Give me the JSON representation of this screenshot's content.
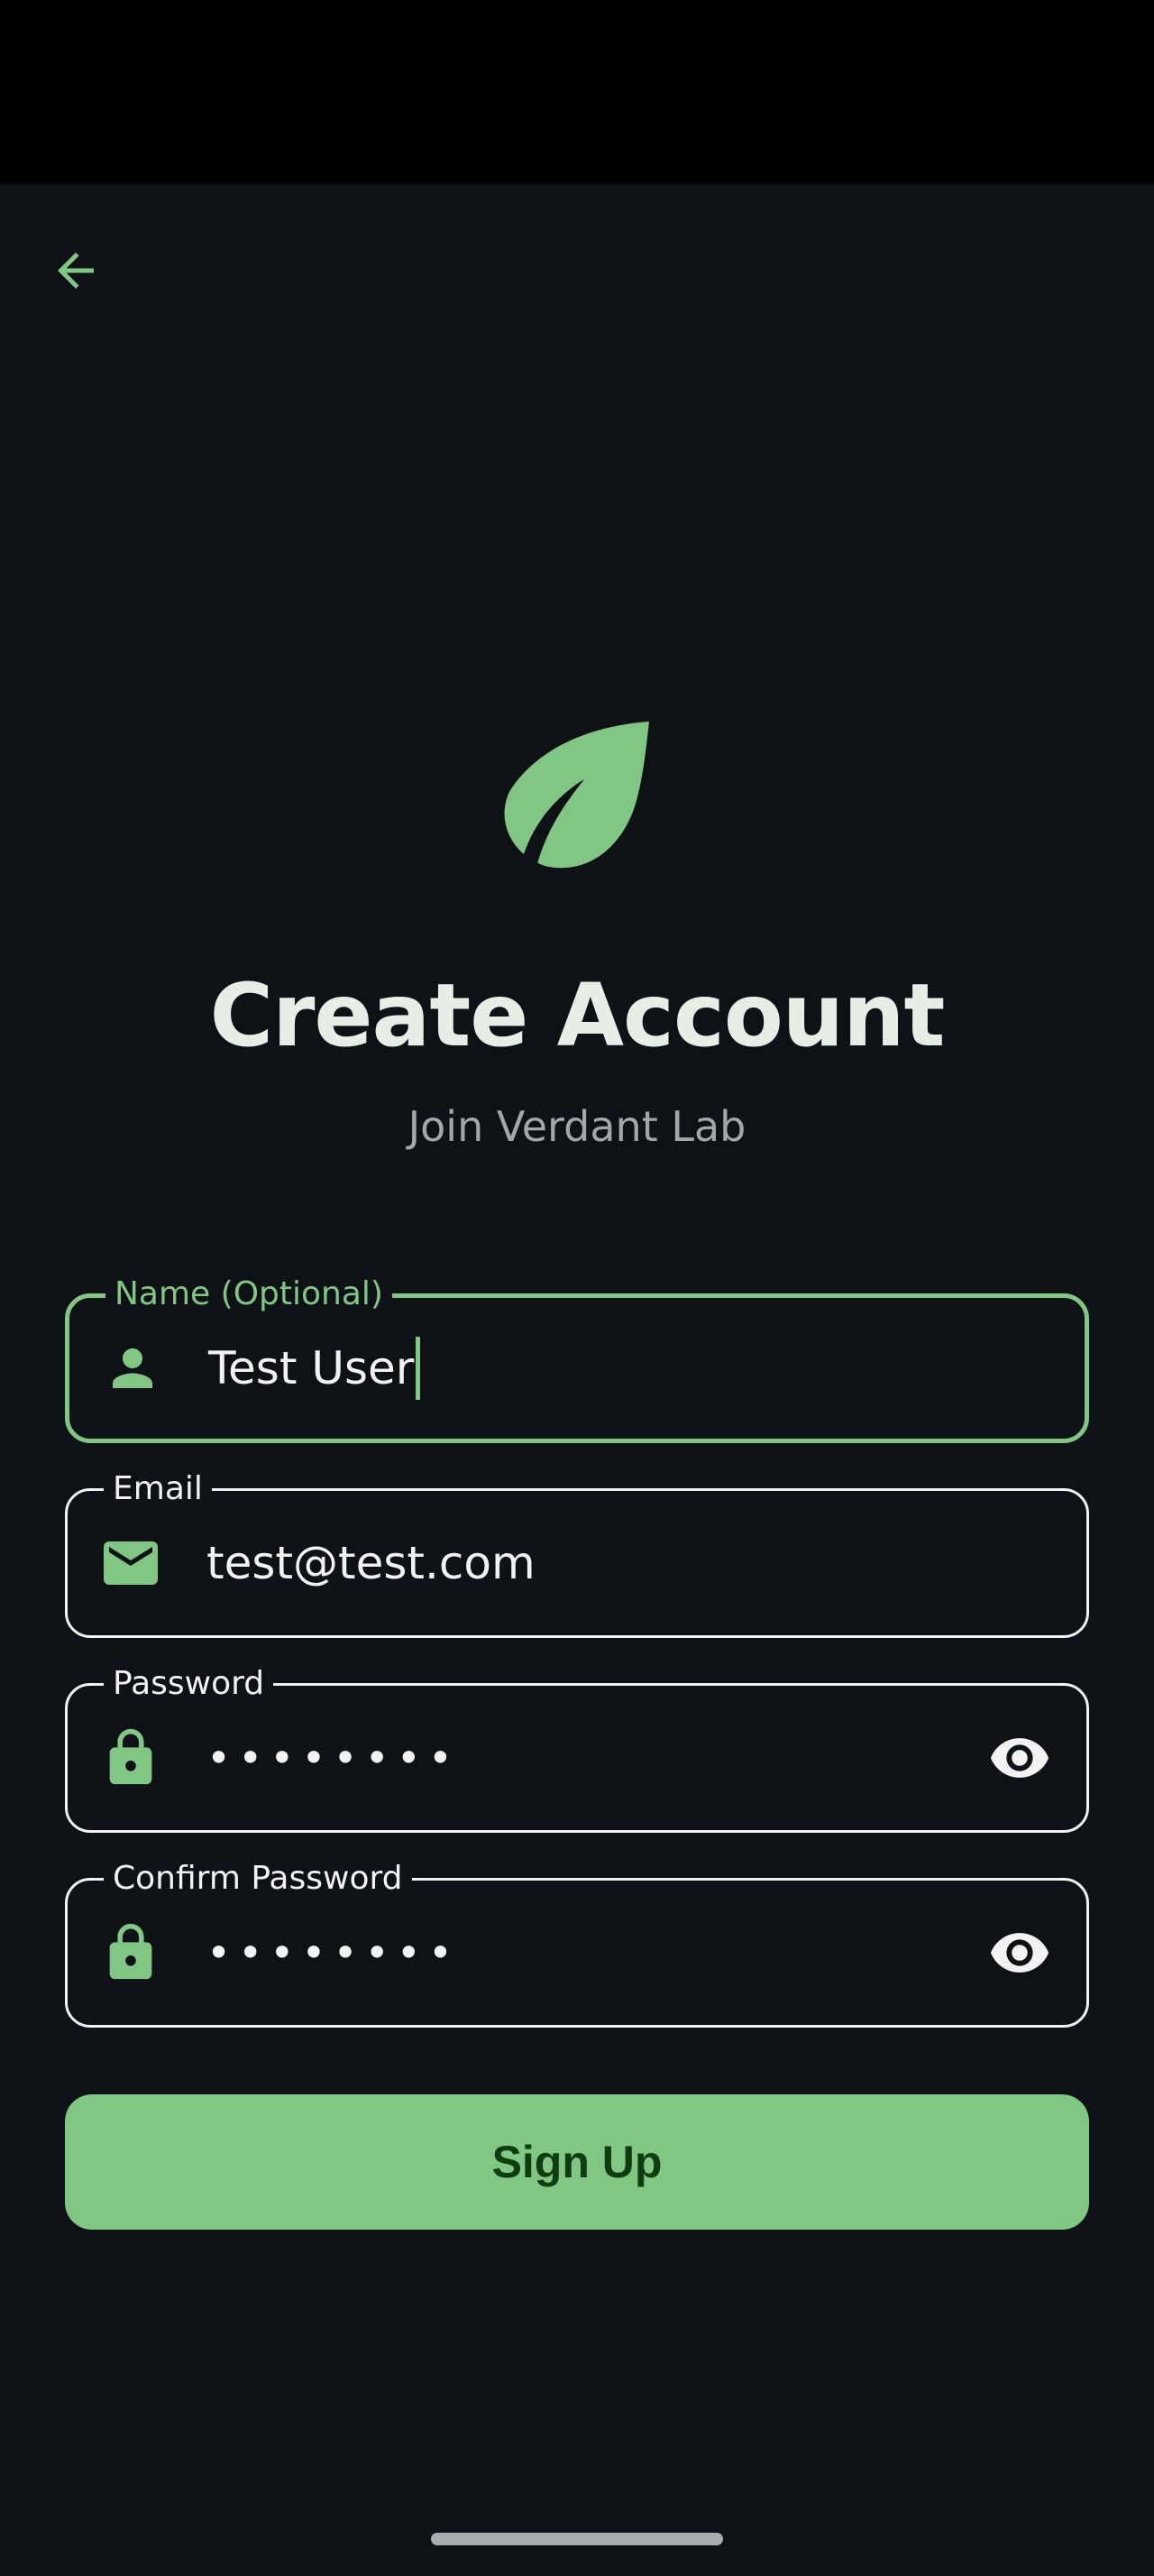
{
  "header": {
    "back_icon": "arrow-left-icon"
  },
  "branding": {
    "logo_icon": "leaf-icon",
    "title": "Create Account",
    "subtitle": "Join Verdant Lab"
  },
  "form": {
    "name": {
      "label": "Name (Optional)",
      "value": "Test User",
      "icon": "person-icon",
      "focused": true
    },
    "email": {
      "label": "Email",
      "value": "test@test.com",
      "icon": "mail-icon"
    },
    "password": {
      "label": "Password",
      "value": "••••••••",
      "icon": "lock-icon",
      "toggle_icon": "eye-icon"
    },
    "confirm_password": {
      "label": "Confirm Password",
      "value": "••••••••",
      "icon": "lock-icon",
      "toggle_icon": "eye-icon"
    },
    "submit_label": "Sign Up"
  },
  "colors": {
    "accent": "#81c784",
    "background": "#0e1216",
    "button_text": "#0e3d10",
    "text_primary": "#e6eee6",
    "text_secondary": "#a2a8a6"
  }
}
